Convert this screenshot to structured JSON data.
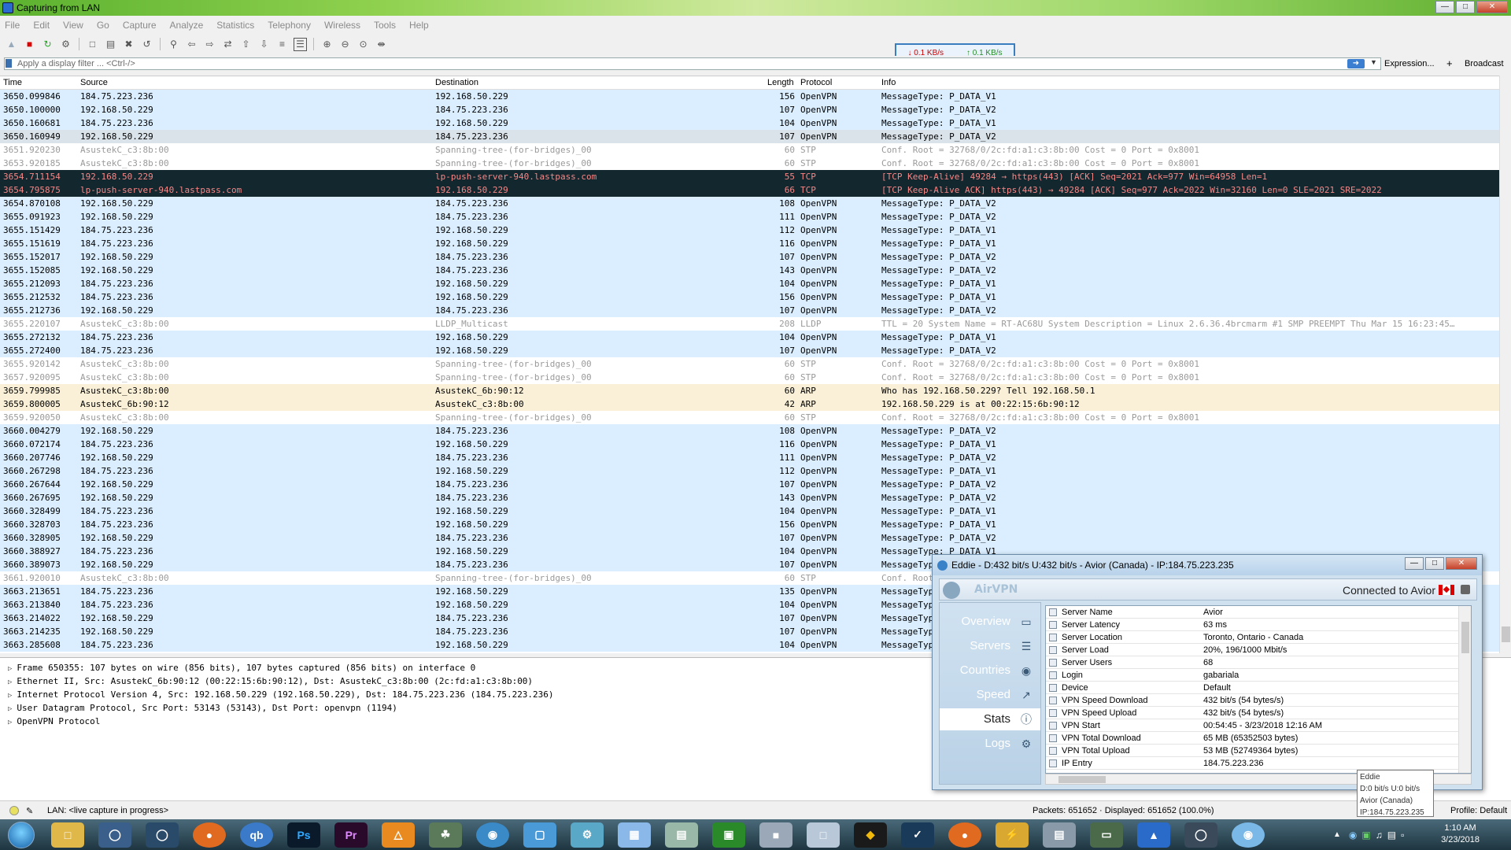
{
  "window": {
    "title": "Capturing from LAN"
  },
  "menu": [
    "File",
    "Edit",
    "View",
    "Go",
    "Capture",
    "Analyze",
    "Statistics",
    "Telephony",
    "Wireless",
    "Tools",
    "Help"
  ],
  "speed": {
    "down": "0.1 KB/s",
    "up": "0.1 KB/s"
  },
  "filter": {
    "placeholder": "Apply a display filter ... <Ctrl-/>",
    "expression_label": "Expression...",
    "plus_label": "+",
    "broadcast_label": "Broadcast"
  },
  "columns": {
    "time": "Time",
    "source": "Source",
    "destination": "Destination",
    "length": "Length",
    "protocol": "Protocol",
    "info": "Info"
  },
  "colors": {
    "openvpn_bg": "#daeeff",
    "stp_bg": "#ffffff",
    "stp_fg": "#9a9a9a",
    "tcp_bg": "#12272e",
    "tcp_fg": "#f78787",
    "arp_bg": "#faf0d7",
    "selected_bg": "#dbe3ea"
  },
  "packets": [
    {
      "time": "3650.099846",
      "src": "184.75.223.236",
      "dst": "192.168.50.229",
      "len": "156",
      "proto": "OpenVPN",
      "info": "MessageType: P_DATA_V1",
      "kind": "openvpn"
    },
    {
      "time": "3650.100000",
      "src": "192.168.50.229",
      "dst": "184.75.223.236",
      "len": "107",
      "proto": "OpenVPN",
      "info": "MessageType: P_DATA_V2",
      "kind": "openvpn"
    },
    {
      "time": "3650.160681",
      "src": "184.75.223.236",
      "dst": "192.168.50.229",
      "len": "104",
      "proto": "OpenVPN",
      "info": "MessageType: P_DATA_V1",
      "kind": "openvpn"
    },
    {
      "time": "3650.160949",
      "src": "192.168.50.229",
      "dst": "184.75.223.236",
      "len": "107",
      "proto": "OpenVPN",
      "info": "MessageType: P_DATA_V2",
      "kind": "selected"
    },
    {
      "time": "3651.920230",
      "src": "AsustekC_c3:8b:00",
      "dst": "Spanning-tree-(for-bridges)_00",
      "len": "60",
      "proto": "STP",
      "info": "Conf. Root = 32768/0/2c:fd:a1:c3:8b:00   Cost = 0   Port = 0x8001",
      "kind": "stp"
    },
    {
      "time": "3653.920185",
      "src": "AsustekC_c3:8b:00",
      "dst": "Spanning-tree-(for-bridges)_00",
      "len": "60",
      "proto": "STP",
      "info": "Conf. Root = 32768/0/2c:fd:a1:c3:8b:00   Cost = 0   Port = 0x8001",
      "kind": "stp"
    },
    {
      "time": "3654.711154",
      "src": "192.168.50.229",
      "dst": "lp-push-server-940.lastpass.com",
      "len": "55",
      "proto": "TCP",
      "info": "[TCP Keep-Alive] 49284 → https(443) [ACK] Seq=2021 Ack=977 Win=64958 Len=1",
      "kind": "tcp"
    },
    {
      "time": "3654.795875",
      "src": "lp-push-server-940.lastpass.com",
      "dst": "192.168.50.229",
      "len": "66",
      "proto": "TCP",
      "info": "[TCP Keep-Alive ACK] https(443) → 49284 [ACK] Seq=977 Ack=2022 Win=32160 Len=0 SLE=2021 SRE=2022",
      "kind": "tcp"
    },
    {
      "time": "3654.870108",
      "src": "192.168.50.229",
      "dst": "184.75.223.236",
      "len": "108",
      "proto": "OpenVPN",
      "info": "MessageType: P_DATA_V2",
      "kind": "openvpn"
    },
    {
      "time": "3655.091923",
      "src": "192.168.50.229",
      "dst": "184.75.223.236",
      "len": "111",
      "proto": "OpenVPN",
      "info": "MessageType: P_DATA_V2",
      "kind": "openvpn"
    },
    {
      "time": "3655.151429",
      "src": "184.75.223.236",
      "dst": "192.168.50.229",
      "len": "112",
      "proto": "OpenVPN",
      "info": "MessageType: P_DATA_V1",
      "kind": "openvpn"
    },
    {
      "time": "3655.151619",
      "src": "184.75.223.236",
      "dst": "192.168.50.229",
      "len": "116",
      "proto": "OpenVPN",
      "info": "MessageType: P_DATA_V1",
      "kind": "openvpn"
    },
    {
      "time": "3655.152017",
      "src": "192.168.50.229",
      "dst": "184.75.223.236",
      "len": "107",
      "proto": "OpenVPN",
      "info": "MessageType: P_DATA_V2",
      "kind": "openvpn"
    },
    {
      "time": "3655.152085",
      "src": "192.168.50.229",
      "dst": "184.75.223.236",
      "len": "143",
      "proto": "OpenVPN",
      "info": "MessageType: P_DATA_V2",
      "kind": "openvpn"
    },
    {
      "time": "3655.212093",
      "src": "184.75.223.236",
      "dst": "192.168.50.229",
      "len": "104",
      "proto": "OpenVPN",
      "info": "MessageType: P_DATA_V1",
      "kind": "openvpn"
    },
    {
      "time": "3655.212532",
      "src": "184.75.223.236",
      "dst": "192.168.50.229",
      "len": "156",
      "proto": "OpenVPN",
      "info": "MessageType: P_DATA_V1",
      "kind": "openvpn"
    },
    {
      "time": "3655.212736",
      "src": "192.168.50.229",
      "dst": "184.75.223.236",
      "len": "107",
      "proto": "OpenVPN",
      "info": "MessageType: P_DATA_V2",
      "kind": "openvpn"
    },
    {
      "time": "3655.220107",
      "src": "AsustekC_c3:8b:00",
      "dst": "LLDP_Multicast",
      "len": "208",
      "proto": "LLDP",
      "info": "TTL = 20 System Name = RT-AC68U System Description =  Linux 2.6.36.4brcmarm #1 SMP PREEMPT Thu Mar 15 16:23:45…",
      "kind": "stp"
    },
    {
      "time": "3655.272132",
      "src": "184.75.223.236",
      "dst": "192.168.50.229",
      "len": "104",
      "proto": "OpenVPN",
      "info": "MessageType: P_DATA_V1",
      "kind": "openvpn"
    },
    {
      "time": "3655.272400",
      "src": "184.75.223.236",
      "dst": "192.168.50.229",
      "len": "107",
      "proto": "OpenVPN",
      "info": "MessageType: P_DATA_V2",
      "kind": "openvpn"
    },
    {
      "time": "3655.920142",
      "src": "AsustekC_c3:8b:00",
      "dst": "Spanning-tree-(for-bridges)_00",
      "len": "60",
      "proto": "STP",
      "info": "Conf. Root = 32768/0/2c:fd:a1:c3:8b:00   Cost = 0   Port = 0x8001",
      "kind": "stp"
    },
    {
      "time": "3657.920095",
      "src": "AsustekC_c3:8b:00",
      "dst": "Spanning-tree-(for-bridges)_00",
      "len": "60",
      "proto": "STP",
      "info": "Conf. Root = 32768/0/2c:fd:a1:c3:8b:00   Cost = 0   Port = 0x8001",
      "kind": "stp"
    },
    {
      "time": "3659.799985",
      "src": "AsustekC_c3:8b:00",
      "dst": "AsustekC_6b:90:12",
      "len": "60",
      "proto": "ARP",
      "info": "Who has 192.168.50.229? Tell 192.168.50.1",
      "kind": "arp"
    },
    {
      "time": "3659.800005",
      "src": "AsustekC_6b:90:12",
      "dst": "AsustekC_c3:8b:00",
      "len": "42",
      "proto": "ARP",
      "info": "192.168.50.229 is at 00:22:15:6b:90:12",
      "kind": "arp"
    },
    {
      "time": "3659.920050",
      "src": "AsustekC_c3:8b:00",
      "dst": "Spanning-tree-(for-bridges)_00",
      "len": "60",
      "proto": "STP",
      "info": "Conf. Root = 32768/0/2c:fd:a1:c3:8b:00   Cost = 0   Port = 0x8001",
      "kind": "stp"
    },
    {
      "time": "3660.004279",
      "src": "192.168.50.229",
      "dst": "184.75.223.236",
      "len": "108",
      "proto": "OpenVPN",
      "info": "MessageType: P_DATA_V2",
      "kind": "openvpn"
    },
    {
      "time": "3660.072174",
      "src": "184.75.223.236",
      "dst": "192.168.50.229",
      "len": "116",
      "proto": "OpenVPN",
      "info": "MessageType: P_DATA_V1",
      "kind": "openvpn"
    },
    {
      "time": "3660.207746",
      "src": "192.168.50.229",
      "dst": "184.75.223.236",
      "len": "111",
      "proto": "OpenVPN",
      "info": "MessageType: P_DATA_V2",
      "kind": "openvpn"
    },
    {
      "time": "3660.267298",
      "src": "184.75.223.236",
      "dst": "192.168.50.229",
      "len": "112",
      "proto": "OpenVPN",
      "info": "MessageType: P_DATA_V1",
      "kind": "openvpn"
    },
    {
      "time": "3660.267644",
      "src": "192.168.50.229",
      "dst": "184.75.223.236",
      "len": "107",
      "proto": "OpenVPN",
      "info": "MessageType: P_DATA_V2",
      "kind": "openvpn"
    },
    {
      "time": "3660.267695",
      "src": "192.168.50.229",
      "dst": "184.75.223.236",
      "len": "143",
      "proto": "OpenVPN",
      "info": "MessageType: P_DATA_V2",
      "kind": "openvpn"
    },
    {
      "time": "3660.328499",
      "src": "184.75.223.236",
      "dst": "192.168.50.229",
      "len": "104",
      "proto": "OpenVPN",
      "info": "MessageType: P_DATA_V1",
      "kind": "openvpn"
    },
    {
      "time": "3660.328703",
      "src": "184.75.223.236",
      "dst": "192.168.50.229",
      "len": "156",
      "proto": "OpenVPN",
      "info": "MessageType: P_DATA_V1",
      "kind": "openvpn"
    },
    {
      "time": "3660.328905",
      "src": "192.168.50.229",
      "dst": "184.75.223.236",
      "len": "107",
      "proto": "OpenVPN",
      "info": "MessageType: P_DATA_V2",
      "kind": "openvpn"
    },
    {
      "time": "3660.388927",
      "src": "184.75.223.236",
      "dst": "192.168.50.229",
      "len": "104",
      "proto": "OpenVPN",
      "info": "MessageType: P_DATA_V1",
      "kind": "openvpn"
    },
    {
      "time": "3660.389073",
      "src": "192.168.50.229",
      "dst": "184.75.223.236",
      "len": "107",
      "proto": "OpenVPN",
      "info": "MessageType: P_DATA_V2",
      "kind": "openvpn"
    },
    {
      "time": "3661.920010",
      "src": "AsustekC_c3:8b:00",
      "dst": "Spanning-tree-(for-bridges)_00",
      "len": "60",
      "proto": "STP",
      "info": "Conf. Root = 32768/0/2c:fd:a1:c3:8b:00   Cost = 0   Port = 0x8001",
      "kind": "stp"
    },
    {
      "time": "3663.213651",
      "src": "184.75.223.236",
      "dst": "192.168.50.229",
      "len": "135",
      "proto": "OpenVPN",
      "info": "MessageType: P_DATA_V1",
      "kind": "openvpn"
    },
    {
      "time": "3663.213840",
      "src": "184.75.223.236",
      "dst": "192.168.50.229",
      "len": "104",
      "proto": "OpenVPN",
      "info": "MessageType: P_DATA_V1",
      "kind": "openvpn"
    },
    {
      "time": "3663.214022",
      "src": "192.168.50.229",
      "dst": "184.75.223.236",
      "len": "107",
      "proto": "OpenVPN",
      "info": "MessageType: P_DATA_V2",
      "kind": "openvpn"
    },
    {
      "time": "3663.214235",
      "src": "192.168.50.229",
      "dst": "184.75.223.236",
      "len": "107",
      "proto": "OpenVPN",
      "info": "MessageType: P_DATA_V2",
      "kind": "openvpn"
    },
    {
      "time": "3663.285608",
      "src": "184.75.223.236",
      "dst": "192.168.50.229",
      "len": "104",
      "proto": "OpenVPN",
      "info": "MessageType: P_DATA_V1",
      "kind": "openvpn"
    }
  ],
  "details": [
    "Frame 650355: 107 bytes on wire (856 bits), 107 bytes captured (856 bits) on interface 0",
    "Ethernet II, Src: AsustekC_6b:90:12 (00:22:15:6b:90:12), Dst: AsustekC_c3:8b:00 (2c:fd:a1:c3:8b:00)",
    "Internet Protocol Version 4, Src: 192.168.50.229 (192.168.50.229), Dst: 184.75.223.236 (184.75.223.236)",
    "User Datagram Protocol, Src Port: 53143 (53143), Dst Port: openvpn (1194)",
    "OpenVPN Protocol"
  ],
  "status": {
    "capture": "LAN: <live capture in progress>",
    "packets": "Packets: 651652 · Displayed: 651652 (100.0%)",
    "profile": "Profile: Default"
  },
  "eddie": {
    "title": "Eddie - D:432 bit/s U:432 bit/s - Avior (Canada) - IP:184.75.223.235",
    "logo": "AirVPN",
    "connected": "Connected to Avior",
    "nav": [
      {
        "label": "Overview",
        "icon": "monitor-icon"
      },
      {
        "label": "Servers",
        "icon": "server-icon"
      },
      {
        "label": "Countries",
        "icon": "globe-icon"
      },
      {
        "label": "Speed",
        "icon": "chart-icon"
      },
      {
        "label": "Stats",
        "icon": "info-icon"
      },
      {
        "label": "Logs",
        "icon": "gears-icon"
      }
    ],
    "active_nav": "Stats",
    "stats": [
      {
        "k": "Server Name",
        "v": "Avior"
      },
      {
        "k": "Server Latency",
        "v": "63 ms"
      },
      {
        "k": "Server Location",
        "v": "Toronto, Ontario - Canada"
      },
      {
        "k": "Server Load",
        "v": "20%, 196/1000 Mbit/s"
      },
      {
        "k": "Server Users",
        "v": "68"
      },
      {
        "k": "Login",
        "v": "gabariala"
      },
      {
        "k": "Device",
        "v": "Default"
      },
      {
        "k": "VPN Speed Download",
        "v": "432 bit/s (54 bytes/s)"
      },
      {
        "k": "VPN Speed Upload",
        "v": "432 bit/s (54 bytes/s)"
      },
      {
        "k": "VPN Start",
        "v": "00:54:45 - 3/23/2018 12:16 AM"
      },
      {
        "k": "VPN Total Download",
        "v": "65 MB (65352503 bytes)"
      },
      {
        "k": "VPN Total Upload",
        "v": "53 MB (52749364 bytes)"
      },
      {
        "k": "IP Entry",
        "v": "184.75.223.236"
      }
    ]
  },
  "tooltip": {
    "l1": "Eddie",
    "l2": "D:0 bit/s U:0 bit/s",
    "l3": "Avior (Canada)",
    "l4": "IP:184.75.223.235"
  },
  "clock": {
    "time": "1:10 AM",
    "date": "3/23/2018"
  }
}
